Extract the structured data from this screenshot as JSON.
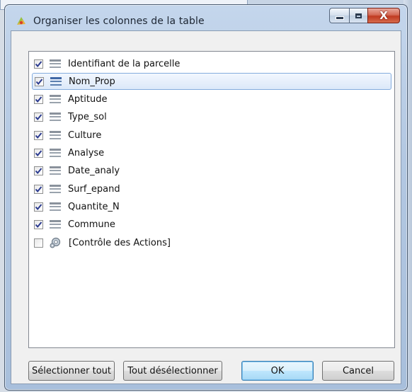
{
  "window": {
    "title": "Organiser les colonnes de la table",
    "controls": {
      "minimize": "minimize",
      "maximize": "maximize",
      "close": "X"
    }
  },
  "columns": {
    "items": [
      {
        "label": "Identifiant de la parcelle",
        "checked": true,
        "icon": "field-icon"
      },
      {
        "label": "Nom_Prop",
        "checked": true,
        "icon": "field-icon",
        "selected": true
      },
      {
        "label": "Aptitude",
        "checked": true,
        "icon": "field-icon"
      },
      {
        "label": "Type_sol",
        "checked": true,
        "icon": "field-icon"
      },
      {
        "label": "Culture",
        "checked": true,
        "icon": "field-icon"
      },
      {
        "label": "Analyse",
        "checked": true,
        "icon": "field-icon"
      },
      {
        "label": "Date_analy",
        "checked": true,
        "icon": "field-icon"
      },
      {
        "label": "Surf_epand",
        "checked": true,
        "icon": "field-icon"
      },
      {
        "label": "Quantite_N",
        "checked": true,
        "icon": "field-icon"
      },
      {
        "label": "Commune",
        "checked": true,
        "icon": "field-icon"
      },
      {
        "label": "[Contrôle des Actions]",
        "checked": false,
        "icon": "gear-icon"
      }
    ]
  },
  "buttons": {
    "select_all": "Sélectionner tout",
    "deselect_all": "Tout désélectionner",
    "ok": "OK",
    "cancel": "Cancel"
  },
  "colors": {
    "selection_border": "#84acdd",
    "checkmark": "#2a3a8f",
    "close_button": "#c03a20"
  }
}
